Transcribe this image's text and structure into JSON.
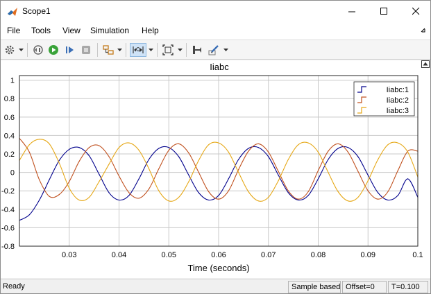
{
  "window": {
    "title": "Scope1"
  },
  "menu": {
    "items": [
      "File",
      "Tools",
      "View",
      "Simulation",
      "Help"
    ]
  },
  "toolbar": {
    "icons": [
      "settings-icon",
      "restore-icon",
      "run-icon",
      "step-forward-icon",
      "stop-icon",
      "highlight-block-icon",
      "zoom-time-icon",
      "fit-to-view-icon",
      "cursor-measure-icon",
      "edit-style-icon"
    ]
  },
  "status": {
    "ready": "Ready",
    "sample": "Sample based",
    "offset": "Offset=0",
    "time": "T=0.100"
  },
  "colors": {
    "series1": "#00008c",
    "series2": "#c0501e",
    "series3": "#e6a817",
    "grid": "#c8c8c8"
  },
  "chart_data": {
    "type": "line",
    "title": "Iiabc",
    "xlabel": "Time (seconds)",
    "ylabel": "",
    "xlim": [
      0.02,
      0.1
    ],
    "ylim": [
      -0.8,
      1.05
    ],
    "x_ticks": [
      0.03,
      0.04,
      0.05,
      0.06,
      0.07,
      0.08,
      0.09,
      0.1
    ],
    "x_tick_labels": [
      "0.03",
      "0.04",
      "0.05",
      "0.06",
      "0.07",
      "0.08",
      "0.09",
      "0.1"
    ],
    "y_ticks": [
      -0.8,
      -0.6,
      -0.4,
      -0.2,
      0,
      0.2,
      0.4,
      0.6,
      0.8,
      1
    ],
    "y_tick_labels": [
      "-0.8",
      "-0.6",
      "-0.4",
      "-0.2",
      "0",
      "0.2",
      "0.4",
      "0.6",
      "0.8",
      "1"
    ],
    "grid": true,
    "legend_position": "top-right",
    "x": [
      0.02,
      0.022,
      0.024,
      0.026,
      0.028,
      0.03,
      0.032,
      0.034,
      0.036,
      0.038,
      0.04,
      0.042,
      0.044,
      0.046,
      0.048,
      0.05,
      0.052,
      0.054,
      0.056,
      0.058,
      0.06,
      0.062,
      0.064,
      0.066,
      0.068,
      0.07,
      0.072,
      0.074,
      0.076,
      0.078,
      0.08,
      0.082,
      0.084,
      0.086,
      0.088,
      0.09,
      0.092,
      0.094,
      0.096,
      0.098,
      0.1
    ],
    "series": [
      {
        "name": "Iiabc:1",
        "values": [
          -0.52,
          -0.46,
          -0.3,
          -0.08,
          0.13,
          0.25,
          0.27,
          0.18,
          -0.02,
          -0.22,
          -0.3,
          -0.25,
          -0.07,
          0.14,
          0.26,
          0.27,
          0.17,
          -0.03,
          -0.22,
          -0.3,
          -0.25,
          -0.07,
          0.14,
          0.26,
          0.27,
          0.17,
          -0.03,
          -0.22,
          -0.3,
          -0.25,
          -0.07,
          0.14,
          0.26,
          0.27,
          0.17,
          -0.03,
          -0.22,
          -0.3,
          -0.25,
          -0.07,
          -0.27
        ]
      },
      {
        "name": "Iiabc:2",
        "values": [
          0.37,
          0.22,
          -0.08,
          -0.26,
          -0.24,
          -0.1,
          0.12,
          0.27,
          0.29,
          0.17,
          -0.04,
          -0.22,
          -0.28,
          -0.18,
          0.04,
          0.24,
          0.31,
          0.21,
          0.0,
          -0.21,
          -0.29,
          -0.2,
          0.03,
          0.23,
          0.31,
          0.22,
          0.01,
          -0.2,
          -0.29,
          -0.21,
          0.02,
          0.23,
          0.31,
          0.22,
          0.01,
          -0.2,
          -0.29,
          -0.21,
          0.02,
          0.23,
          0.23
        ]
      },
      {
        "name": "Iiabc:3",
        "values": [
          0.13,
          0.3,
          0.36,
          0.31,
          0.1,
          -0.17,
          -0.3,
          -0.27,
          -0.1,
          0.09,
          0.27,
          0.32,
          0.24,
          0.04,
          -0.2,
          -0.31,
          -0.27,
          -0.1,
          0.13,
          0.3,
          0.32,
          0.22,
          0.0,
          -0.21,
          -0.31,
          -0.27,
          -0.09,
          0.14,
          0.3,
          0.32,
          0.22,
          0.0,
          -0.21,
          -0.31,
          -0.27,
          -0.09,
          0.14,
          0.3,
          0.32,
          0.22,
          -0.05
        ]
      }
    ]
  }
}
